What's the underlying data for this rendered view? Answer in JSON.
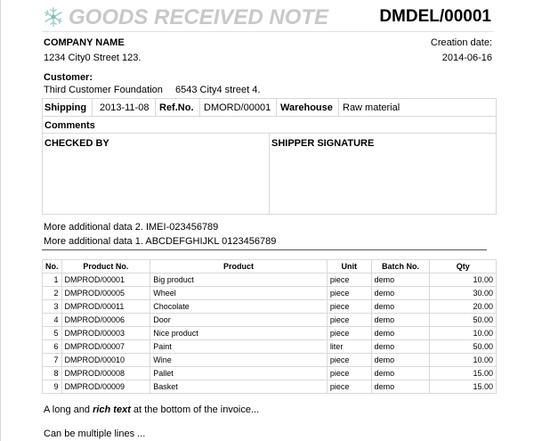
{
  "header": {
    "title": "GOODS RECEIVED NOTE",
    "doc_number": "DMDEL/00001",
    "logo_icon": "snowflake-logo-icon"
  },
  "company": {
    "name": "COMPANY NAME",
    "address": "1234 City0 Street 123.",
    "creation_label": "Creation date:",
    "creation_date": "2014-06-16"
  },
  "customer": {
    "label": "Customer:",
    "name": "Third Customer Foundation",
    "address": "6543 City4 street 4."
  },
  "info": {
    "shipping_label": "Shipping",
    "shipping_date": "2013-11-08",
    "refno_label": "Ref.No.",
    "refno_value": "DMORD/00001",
    "warehouse_label": "Warehouse",
    "warehouse_value": "Raw material"
  },
  "comments": {
    "label": "Comments"
  },
  "signatures": {
    "checked_by": "CHECKED BY",
    "shipper": "SHIPPER SIGNATURE"
  },
  "extra": {
    "line1": "More additional data 2. IMEI-023456789",
    "line2": "More additional data 1. ABCDEFGHIJKL 0123456789"
  },
  "items_table": {
    "headers": [
      "No.",
      "Product No.",
      "Product",
      "Unit",
      "Batch No.",
      "Qty"
    ],
    "rows": [
      [
        "1",
        "DMPROD/00001",
        "Big product",
        "piece",
        "demo",
        "10.00"
      ],
      [
        "2",
        "DMPROD/00005",
        "Wheel",
        "piece",
        "demo",
        "30.00"
      ],
      [
        "3",
        "DMPROD/00011",
        "Chocolate",
        "piece",
        "demo",
        "20.00"
      ],
      [
        "4",
        "DMPROD/00006",
        "Door",
        "piece",
        "demo",
        "50.00"
      ],
      [
        "5",
        "DMPROD/00003",
        "Nice product",
        "piece",
        "demo",
        "10.00"
      ],
      [
        "6",
        "DMPROD/00007",
        "Paint",
        "liter",
        "demo",
        "50.00"
      ],
      [
        "7",
        "DMPROD/00010",
        "Wine",
        "piece",
        "demo",
        "10.00"
      ],
      [
        "8",
        "DMPROD/00008",
        "Pallet",
        "piece",
        "demo",
        "15.00"
      ],
      [
        "9",
        "DMPROD/00009",
        "Basket",
        "piece",
        "demo",
        "15.00"
      ]
    ]
  },
  "footer": {
    "line1_pre": "A long and ",
    "line1_rich": "rich text",
    "line1_post": " at the bottom of the invoice...",
    "line2": "Can be multiple lines ..."
  }
}
